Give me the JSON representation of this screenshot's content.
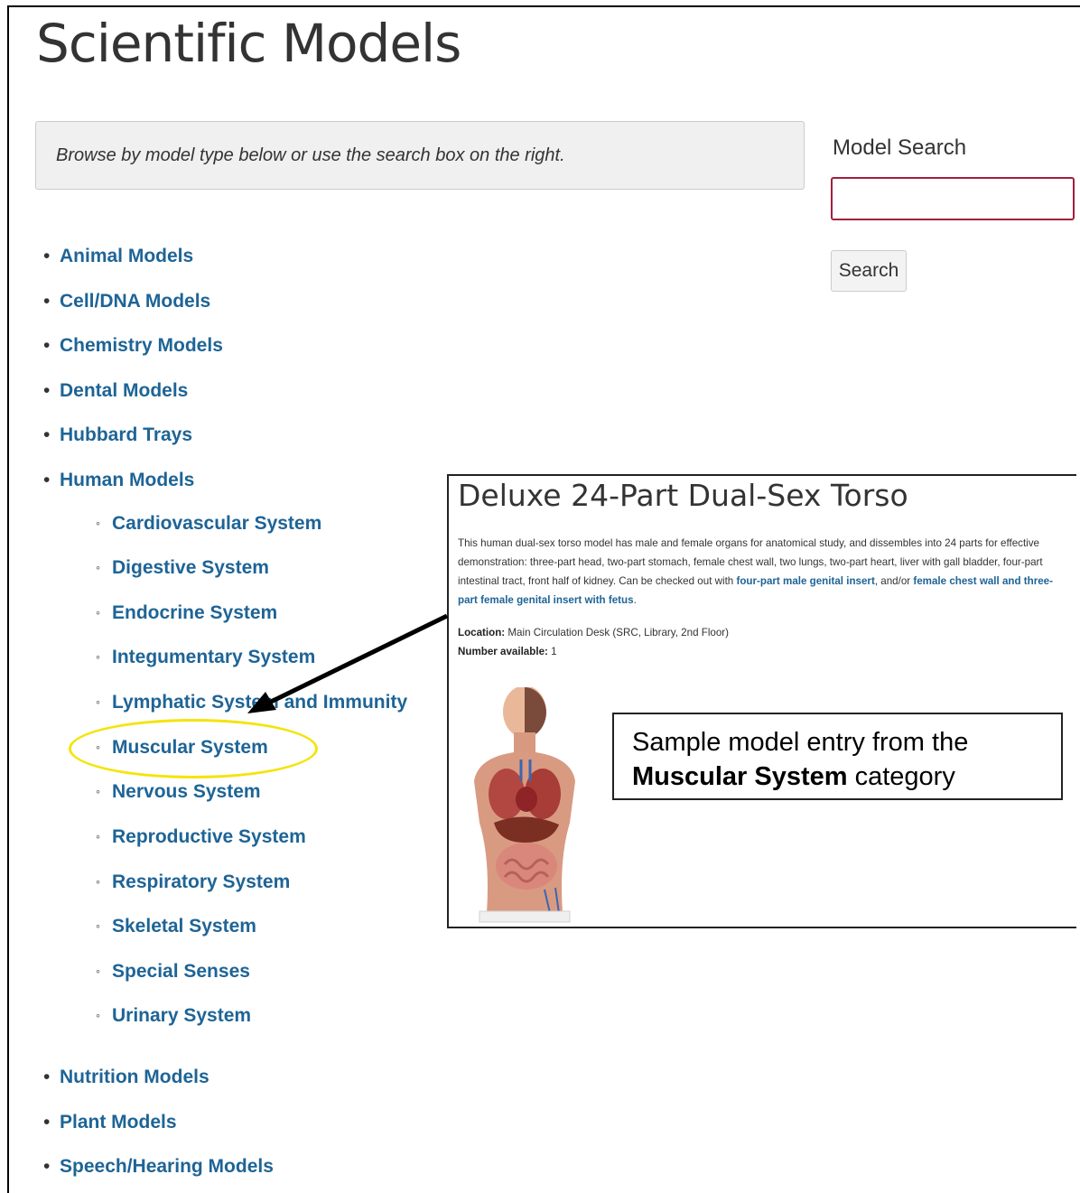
{
  "page": {
    "title": "Scientific Models"
  },
  "browse": {
    "instructions": "Browse by model type below or use the search box on the right."
  },
  "search": {
    "label": "Model Search",
    "button_label": "Search",
    "value": ""
  },
  "categories": [
    {
      "label": "Animal Models"
    },
    {
      "label": "Cell/DNA Models"
    },
    {
      "label": "Chemistry Models"
    },
    {
      "label": "Dental Models"
    },
    {
      "label": "Hubbard Trays"
    },
    {
      "label": "Human Models"
    },
    {
      "label": "Nutrition Models"
    },
    {
      "label": "Plant Models"
    },
    {
      "label": "Speech/Hearing Models"
    }
  ],
  "human_subcategories": [
    {
      "label": "Cardiovascular System"
    },
    {
      "label": "Digestive System"
    },
    {
      "label": "Endocrine System"
    },
    {
      "label": "Integumentary System"
    },
    {
      "label": "Lymphatic System and Immunity"
    },
    {
      "label": "Muscular System"
    },
    {
      "label": "Nervous System"
    },
    {
      "label": "Reproductive System"
    },
    {
      "label": "Respiratory System"
    },
    {
      "label": "Skeletal System"
    },
    {
      "label": "Special Senses"
    },
    {
      "label": "Urinary System"
    }
  ],
  "entry": {
    "title": "Deluxe 24-Part Dual-Sex Torso",
    "description": "This human dual-sex torso model has male and female organs for anatomical study, and dissembles into 24 parts for effective demonstration: three-part head, two-part stomach, female chest wall, two lungs, two-part heart, liver with gall bladder, four-part intestinal tract, front half of kidney. Can be checked out with ",
    "link1": "four-part male genital insert",
    "between": ", and/or ",
    "link2": "female chest wall and three-part female genital insert with fetus",
    "end": ".",
    "location_label": "Location:",
    "location_value": " Main Circulation Desk (SRC, Library, 2nd Floor)",
    "number_label": "Number available:",
    "number_value": " 1"
  },
  "callout": {
    "prefix": "Sample model entry from the",
    "bold": "Muscular System",
    "suffix": " category"
  },
  "colors": {
    "link": "#1e6496",
    "highlight": "#f4e40c",
    "search_border": "#a21f3c"
  }
}
